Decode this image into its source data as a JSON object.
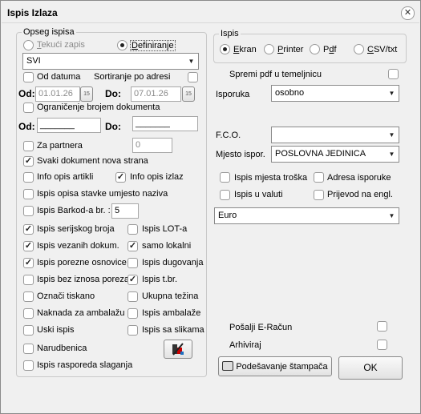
{
  "window": {
    "title": "Ispis Izlaza",
    "close_glyph": "✕"
  },
  "scope": {
    "group_label": "Opseg ispisa",
    "radio_current_prefix": "T",
    "radio_current_rest": "ekući zapis",
    "radio_define_prefix": "D",
    "radio_define_rest": "efiniranje",
    "selected_radio": "define",
    "scope_select": "SVI",
    "by_date_label": "Od datuma",
    "sort_by_address_label": "Sortiranje po adresi",
    "from_label": "Od:",
    "to_label": "Do:",
    "date_from": "01.01.26",
    "date_to": "07.01.26",
    "calendar_glyph": "15",
    "limit_docs_label": "Ograničenje brojem dokumenta",
    "doc_from_label": "Od:",
    "doc_to_label": "Do:",
    "doc_from_value": "_______",
    "doc_to_value": "_______",
    "partner_label": "Za partnera",
    "partner_value": "0",
    "options": {
      "new_page": {
        "label": "Svaki dokument nova strana",
        "checked": true
      },
      "item_info": {
        "label": "Info opis artikli",
        "checked": false
      },
      "output_info": {
        "label": "Info opis izlaz",
        "checked": true
      },
      "item_desc_instead_name": {
        "label": "Ispis opisa stavke umjesto naziva",
        "checked": false
      },
      "barcode": {
        "label": "Ispis Barkod-a br. :",
        "checked": false
      },
      "barcode_value": "5",
      "serial": {
        "label": "Ispis serijskog broja",
        "checked": true
      },
      "lot": {
        "label": "Ispis LOT-a",
        "checked": false
      },
      "linked_docs": {
        "label": "Ispis vezanih dokum.",
        "checked": true
      },
      "local_only": {
        "label": "samo lokalni",
        "checked": true
      },
      "tax_base": {
        "label": "Ispis porezne osnovice",
        "checked": true
      },
      "debt": {
        "label": "Ispis dugovanja",
        "checked": false
      },
      "no_tax_amount": {
        "label": "Ispis bez iznosa poreza",
        "checked": false
      },
      "tbr": {
        "label": "Ispis t.br.",
        "checked": true
      },
      "mark_printed": {
        "label": "Označi tiskano",
        "checked": false
      },
      "total_weight": {
        "label": "Ukupna težina",
        "checked": false
      },
      "packaging_fee": {
        "label": "Naknada za ambalažu",
        "checked": false
      },
      "packaging": {
        "label": "Ispis ambalaže",
        "checked": false
      },
      "narrow": {
        "label": "Uski ispis",
        "checked": false
      },
      "with_images": {
        "label": "Ispis sa slikama",
        "checked": false
      },
      "order": {
        "label": "Narudbenica",
        "checked": false
      },
      "stacking": {
        "label": "Ispis rasporeda slaganja",
        "checked": false
      }
    }
  },
  "output": {
    "group_label": "Ispis",
    "screen_prefix": "E",
    "screen_rest": "kran",
    "printer_prefix": "P",
    "printer_rest": "rinter",
    "pdf_prefix": "P",
    "pdf_mid": "d",
    "pdf_rest": "f",
    "csv_prefix": "C",
    "csv_rest": "SV/txt",
    "selected": "screen"
  },
  "right": {
    "save_pdf_label": "Spremi pdf u temeljnicu",
    "delivery_label": "Isporuka",
    "delivery_value": "osobno",
    "fco_label": "F.C.O.",
    "fco_value": "",
    "place_label": "Mjesto ispor.",
    "place_value": "POSLOVNA JEDINICA",
    "cost_center_label": "Ispis mjesta troška",
    "delivery_address_label": "Adresa isporuke",
    "in_currency_label": "Ispis u valuti",
    "translate_label": "Prijevod na engl.",
    "currency_value": "Euro",
    "send_einvoice_label": "Pošalji E-Račun",
    "archive_label": "Arhiviraj"
  },
  "buttons": {
    "printer_settings_label": "Podešavanje štampača",
    "ok_label": "OK"
  },
  "colors": {
    "window_bg": "#f0f0f0",
    "disabled_text": "#8a8a8a"
  }
}
